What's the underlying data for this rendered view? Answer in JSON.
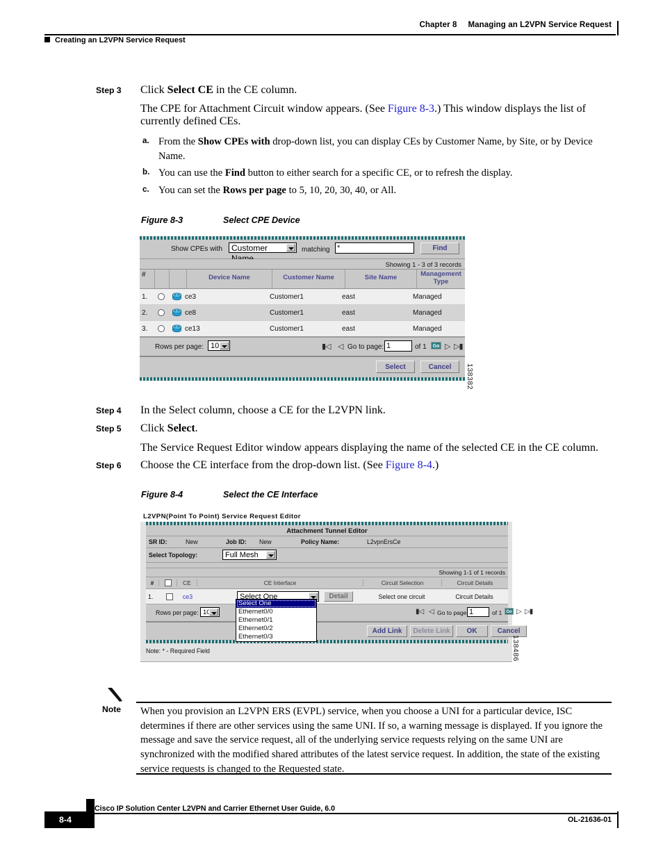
{
  "header": {
    "chapter": "Chapter 8",
    "chapter_title": "Managing an L2VPN Service Request",
    "section": "Creating an L2VPN Service Request"
  },
  "steps": {
    "step3_label": "Step 3",
    "step3_line1_pre": "Click ",
    "step3_line1_bold": "Select CE",
    "step3_line1_post": " in the CE column.",
    "step3_para_pre": "The CPE for Attachment Circuit window appears. (See ",
    "step3_para_xref": "Figure 8-3",
    "step3_para_post": ".) This window displays the list of currently defined CEs.",
    "sub_a_marker": "a.",
    "sub_a_pre": "From the ",
    "sub_a_bold": "Show CPEs with",
    "sub_a_post": " drop-down list, you can display CEs by Customer Name, by Site, or by Device Name.",
    "sub_b_marker": "b.",
    "sub_b_pre": "You can use the ",
    "sub_b_bold": "Find",
    "sub_b_post": " button to either search for a specific CE, or to refresh the display.",
    "sub_c_marker": "c.",
    "sub_c_pre": "You can set the ",
    "sub_c_bold": "Rows per page",
    "sub_c_post": " to 5, 10, 20, 30, 40, or All.",
    "step4_label": "Step 4",
    "step4_text": "In the Select column, choose a CE for the L2VPN link.",
    "step5_label": "Step 5",
    "step5_pre": "Click ",
    "step5_bold": "Select",
    "step5_post": ".",
    "step5_para": "The Service Request Editor window appears displaying the name of the selected CE in the CE column.",
    "step6_label": "Step 6",
    "step6_pre": "Choose the CE interface from the drop-down list. (See ",
    "step6_xref": "Figure 8-4",
    "step6_post": ".)"
  },
  "figure83": {
    "caption_number": "Figure 8-3",
    "caption_title": "Select CPE Device",
    "side_code": "138382",
    "toolbar": {
      "show_label": "Show CPEs with",
      "filter_value": "Customer Name",
      "matching_label": "matching",
      "matching_value": "*",
      "find_button": "Find"
    },
    "records_text": "Showing 1 - 3 of 3 records",
    "columns": [
      "#",
      "",
      "",
      "Device Name",
      "Customer Name",
      "Site Name",
      "Management Type"
    ],
    "rows": [
      {
        "num": "1.",
        "device": "ce3",
        "customer": "Customer1",
        "site": "east",
        "mgmt": "Managed"
      },
      {
        "num": "2.",
        "device": "ce8",
        "customer": "Customer1",
        "site": "east",
        "mgmt": "Managed"
      },
      {
        "num": "3.",
        "device": "ce13",
        "customer": "Customer1",
        "site": "east",
        "mgmt": "Managed"
      }
    ],
    "pager": {
      "rows_label": "Rows per page:",
      "rows_value": "10",
      "goto_label": "Go to page:",
      "page_value": "1",
      "of_label": "of 1",
      "go_button": "Go"
    },
    "buttons": {
      "select": "Select",
      "cancel": "Cancel"
    }
  },
  "figure84": {
    "caption_number": "Figure 8-4",
    "caption_title": "Select the CE Interface",
    "side_code": "138486",
    "window_title": "L2VPN(Point To Point) Service Request Editor",
    "panel_title": "Attachment Tunnel Editor",
    "fields": {
      "sr_id_label": "SR ID:",
      "sr_id_value": "New",
      "job_id_label": "Job ID:",
      "job_id_value": "New",
      "policy_label": "Policy Name:",
      "policy_value": "L2vpnErsCe",
      "topology_label": "Select Topology:",
      "topology_value": "Full Mesh"
    },
    "records_text": "Showing 1-1 of 1 records",
    "columns": [
      "#",
      "",
      "CE",
      "CE Interface",
      "Circuit Selection",
      "Circuit Details"
    ],
    "row": {
      "num": "1.",
      "ce": "ce3",
      "interface_value": "Select One",
      "detail_button": "Detail",
      "circuit_selection": "Select one circuit",
      "circuit_details": "Circuit Details"
    },
    "dropdown_options": [
      "Select One",
      "Ethernet0/0",
      "Ethernet0/1",
      "Ethernet0/2",
      "Ethernet0/3"
    ],
    "pager": {
      "rows_label": "Rows per page:",
      "rows_value": "10",
      "goto_label": "Go to page:",
      "page_value": "1",
      "of_label": "of 1",
      "go_button": "Go"
    },
    "buttons": {
      "add_link": "Add Link",
      "delete_link": "Delete Link",
      "ok": "OK",
      "cancel": "Cancel"
    },
    "required_note": "Note: * - Required Field"
  },
  "note": {
    "label": "Note",
    "text": "When you provision an L2VPN ERS (EVPL) service, when you choose a UNI for a particular device, ISC determines if there are other services using the same UNI. If so, a warning message is displayed. If you ignore the message and save the service request, all of the underlying service requests relying on the same UNI are synchronized with the modified shared attributes of the latest service request. In addition, the state of the existing service requests is changed to the Requested state."
  },
  "footer": {
    "page_number": "8-4",
    "guide_title": "Cisco IP Solution Center L2VPN and Carrier Ethernet User Guide, 6.0",
    "doc_number": "OL-21636-01"
  },
  "colors": {
    "accent_teal": "#1d6e73",
    "link_blue": "#2222cc",
    "header_text": "#4a4a8e",
    "panel_gray": "#c9c9c9"
  }
}
